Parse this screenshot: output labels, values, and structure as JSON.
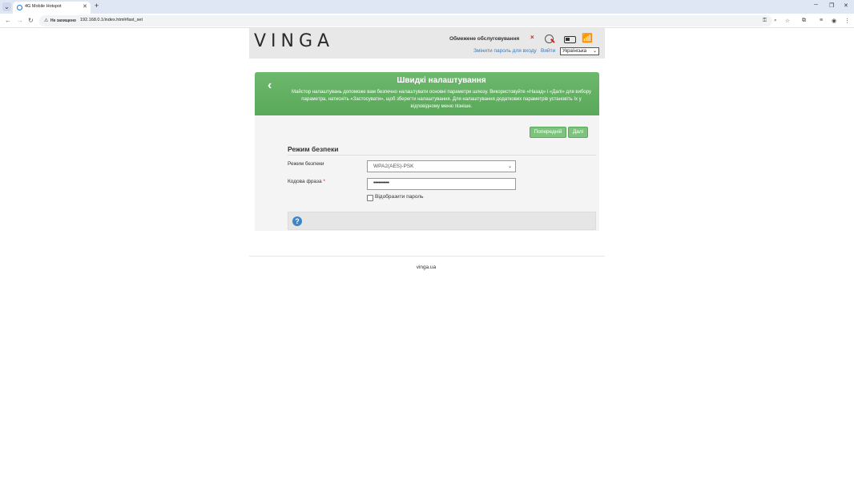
{
  "browser": {
    "tab_title": "4G Mobile Hotspot",
    "tab_close": "✕",
    "new_tab": "+",
    "insecure_label": "Не захищено",
    "url": "192.168.0.1/index.html#fast_set",
    "icons": [
      "back-icon",
      "forward-icon",
      "reload-icon",
      "key-icon",
      "zoom-icon",
      "star-icon",
      "extensions-icon",
      "media-icon",
      "profile-icon",
      "menu-icon"
    ]
  },
  "header": {
    "logo": "VINGA",
    "status": "Обмежене обслуговування",
    "change_password": "Змінити пароль для входу",
    "logout": "Вийти",
    "language": "Українська"
  },
  "wizard": {
    "title": "Швидкі налаштування",
    "description": "Майстор налаштувань допоможе вам безпечно налаштувати основні параметри шлюзу. Використовуйте «Назад» і «Далі» для вибору параметра, натисніть «Застосувати», щоб зберегти налаштування. Для налаштування додаткових параметрів установіть їх у відповідному меню пізніше.",
    "prev_button": "Попередній",
    "next_button": "Далі",
    "section_title": "Режим безпеки",
    "mode_label": "Режим безпеки",
    "mode_value": "WPA2(AES)-PSK",
    "passphrase_label": "Кодова фраза",
    "required_mark": "*",
    "passphrase_value": "••••••••••",
    "show_password_label": "Відобразити пароль",
    "help_symbol": "?"
  },
  "footer": {
    "link": "vinga.ua"
  },
  "colors": {
    "banner": "#5aa85a",
    "button": "#7cc47c",
    "link": "#3a7ab8",
    "alert": "#d02020"
  }
}
